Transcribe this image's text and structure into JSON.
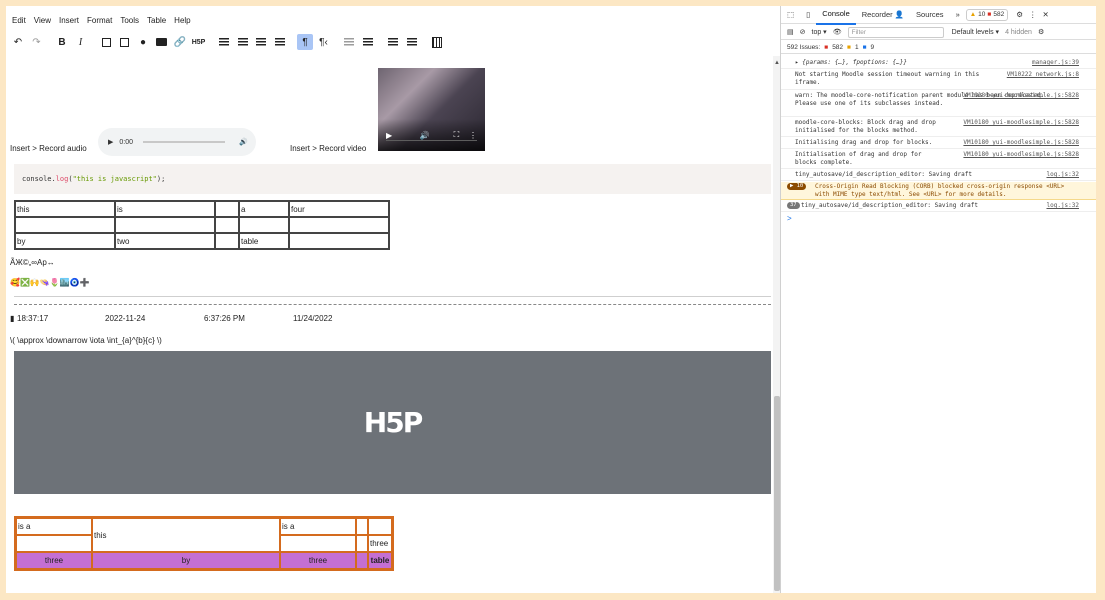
{
  "menu": [
    "Edit",
    "View",
    "Insert",
    "Format",
    "Tools",
    "Table",
    "Help"
  ],
  "toolbar": {
    "undo": "↶",
    "redo": "↷",
    "bold": "B",
    "italic": "I",
    "h5p": "H5P",
    "para_marks": "¶",
    "rtl": "¶‹"
  },
  "editor": {
    "audio_caption": "Insert > Record audio",
    "video_caption": "Insert > Record video",
    "audio_time": "0:00",
    "code_prefix": "console.",
    "code_fn": "log",
    "code_open": "(",
    "code_string": "\"this is javascript\"",
    "code_close": ");",
    "table1": [
      [
        "this",
        "is",
        "",
        "a",
        "four"
      ],
      [
        "",
        "",
        "",
        "",
        ""
      ],
      [
        "by",
        "two",
        "",
        "table",
        ""
      ]
    ],
    "special_chars": "ÃЖ©„∞Ap↔",
    "emoji_row": "🥰❎🙌👒🌷🏙️🧿➕",
    "datetime": [
      "18:37:17",
      "2022-11-24",
      "6:37:26 PM",
      "11/24/2022"
    ],
    "math": "\\( \\approx \\downarrow \\iota \\int_{a}^{b}{c} \\)",
    "h5p_logo": "H5P",
    "table2": {
      "r1": [
        "is a",
        "this",
        "is a",
        "",
        ""
      ],
      "r2": [
        "",
        "",
        "",
        "three"
      ],
      "r3": [
        "three",
        "by",
        "three",
        "",
        "table"
      ]
    }
  },
  "devtools": {
    "tabs": [
      "Console",
      "Recorder 👤",
      "Sources",
      "»"
    ],
    "warn_count": "10",
    "error_count": "582",
    "context": "top ▾",
    "filter_placeholder": "Filter",
    "levels": "Default levels ▾",
    "hidden": "4 hidden",
    "issues_label": "592 Issues:",
    "issues_err": "582",
    "issues_warn": "1",
    "issues_info": "9",
    "logs": [
      {
        "text": "▸ {params: {…}, fpoptions: {…}}",
        "src": "manager.js:39"
      },
      {
        "text": "Not starting Moodle session timeout warning in this iframe.",
        "src": "VM10222 network.js:8"
      },
      {
        "text": "warn: The moodle-core-notification parent module has been deprecated. Please use one of its subclasses instead.",
        "src": "VM10180 yui-moodlesimple.js:5828"
      },
      {
        "text": "moodle-core-blocks: Block drag and drop initialised for the blocks method.",
        "src": "VM10180 yui-moodlesimple.js:5828"
      },
      {
        "text": "Initialising drag and drop for blocks.",
        "src": "VM10180 yui-moodlesimple.js:5828"
      },
      {
        "text": "Initialisation of drag and drop for blocks complete.",
        "src": "VM10180 yui-moodlesimple.js:5828"
      },
      {
        "text": "tiny_autosave/id_description_editor: Saving draft",
        "src": "log.js:32"
      }
    ],
    "error_log": {
      "count": "▶ 10",
      "text": "Cross-Origin Read Blocking (CORB) blocked cross-origin response <URL> with MIME type text/html. See <URL> for more details."
    },
    "repeat_log": {
      "count": "37",
      "text": "tiny_autosave/id_description_editor: Saving draft",
      "src": "log.js:32"
    },
    "prompt": ">"
  },
  "colors": {
    "accent": "#1a73e8",
    "table2_border": "#d46b1e",
    "table2_fill": "#c46fd3",
    "h5p_bg": "#6d7278",
    "page_bg": "#fce7c4"
  }
}
